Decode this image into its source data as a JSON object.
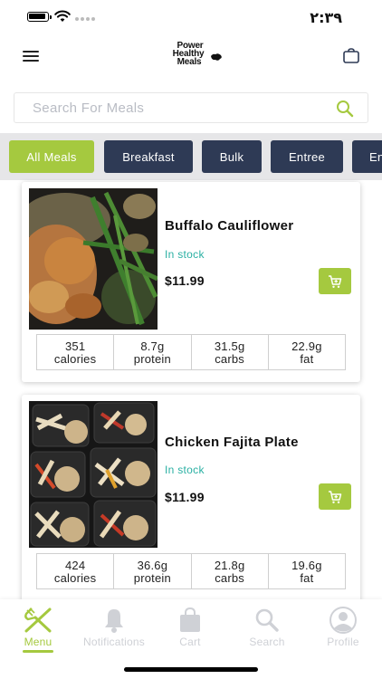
{
  "status_bar": {
    "time": "٢:٣٩"
  },
  "header": {
    "logo_lines": [
      "Power",
      "Healthy",
      "Meals"
    ]
  },
  "search": {
    "placeholder": "Search For Meals",
    "value": ""
  },
  "categories": [
    {
      "label": "All Meals",
      "active": true
    },
    {
      "label": "Breakfast",
      "active": false
    },
    {
      "label": "Bulk",
      "active": false
    },
    {
      "label": "Entree",
      "active": false
    },
    {
      "label": "En",
      "active": false
    }
  ],
  "meals": [
    {
      "name": "Buffalo Cauliflower",
      "stock": "In stock",
      "price": "$11.99",
      "nutrition": [
        {
          "value": "351",
          "label": "calories"
        },
        {
          "value": "8.7g",
          "label": "protein"
        },
        {
          "value": "31.5g",
          "label": "carbs"
        },
        {
          "value": "22.9g",
          "label": "fat"
        }
      ]
    },
    {
      "name": "Chicken Fajita Plate",
      "stock": "In stock",
      "price": "$11.99",
      "nutrition": [
        {
          "value": "424",
          "label": "calories"
        },
        {
          "value": "36.6g",
          "label": "protein"
        },
        {
          "value": "21.8g",
          "label": "carbs"
        },
        {
          "value": "19.6g",
          "label": "fat"
        }
      ]
    }
  ],
  "tabs": [
    {
      "label": "Menu",
      "icon": "utensils-icon",
      "active": true
    },
    {
      "label": "Notifications",
      "icon": "bell-icon",
      "active": false
    },
    {
      "label": "Cart",
      "icon": "shopping-bag-icon",
      "active": false
    },
    {
      "label": "Search",
      "icon": "search-icon",
      "active": false
    },
    {
      "label": "Profile",
      "icon": "profile-icon",
      "active": false
    }
  ],
  "colors": {
    "accent": "#a5c93f",
    "chip_dark": "#2e3a55",
    "stock_green": "#2ab0a3",
    "inactive_tab": "#cfd1d6"
  }
}
